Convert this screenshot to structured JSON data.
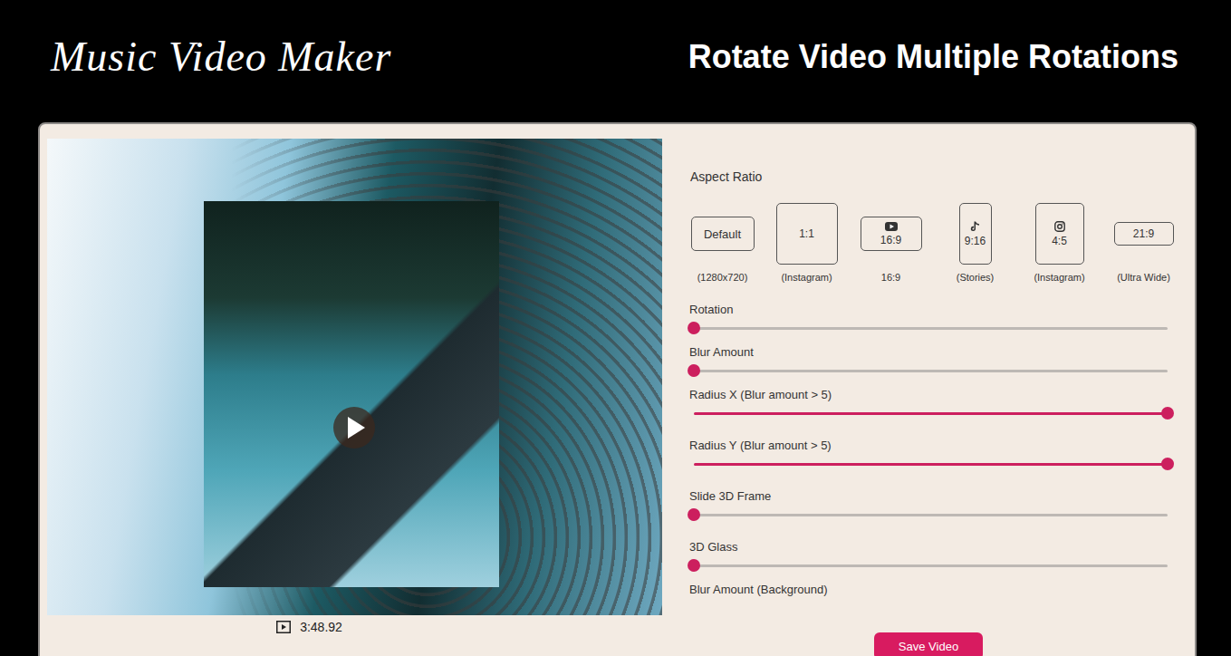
{
  "app": {
    "title": "Music Video Maker",
    "heading": "Rotate Video Multiple Rotations"
  },
  "preview": {
    "time": "3:48.92"
  },
  "aspect_ratio": {
    "label": "Aspect Ratio",
    "options": [
      {
        "label": "Default",
        "caption": "(1280x720)",
        "kind": "wide",
        "selected": false
      },
      {
        "label": "1:1",
        "caption": "(Instagram)",
        "kind": "square",
        "selected": false
      },
      {
        "label": "16:9",
        "caption": "16:9",
        "kind": "video",
        "selected": false
      },
      {
        "label": "9:16",
        "caption": "(Stories)",
        "kind": "tall",
        "selected": false
      },
      {
        "label": "4:5",
        "caption": "(Instagram)",
        "kind": "portrait",
        "selected": false
      },
      {
        "label": "21:9",
        "caption": "(Ultra Wide)",
        "kind": "ultrawide",
        "selected": false
      }
    ]
  },
  "controls": [
    {
      "label": "Rotation",
      "kind": "slider",
      "level": 0
    },
    {
      "label": "Blur Amount",
      "kind": "slider",
      "level": 0
    },
    {
      "label": "Radius X (Blur amount > 5)",
      "kind": "slider",
      "level": 1
    },
    {
      "label": "Radius Y (Blur amount > 5)",
      "kind": "slider",
      "level": 1
    },
    {
      "label": "Slide 3D Frame",
      "kind": "slider",
      "level": 0
    },
    {
      "label": "3D Glass",
      "kind": "slider",
      "level": 0
    },
    {
      "label": "Blur Amount (Background)",
      "kind": "label",
      "level": 0
    }
  ],
  "save_button": {
    "label": "Save Video"
  }
}
